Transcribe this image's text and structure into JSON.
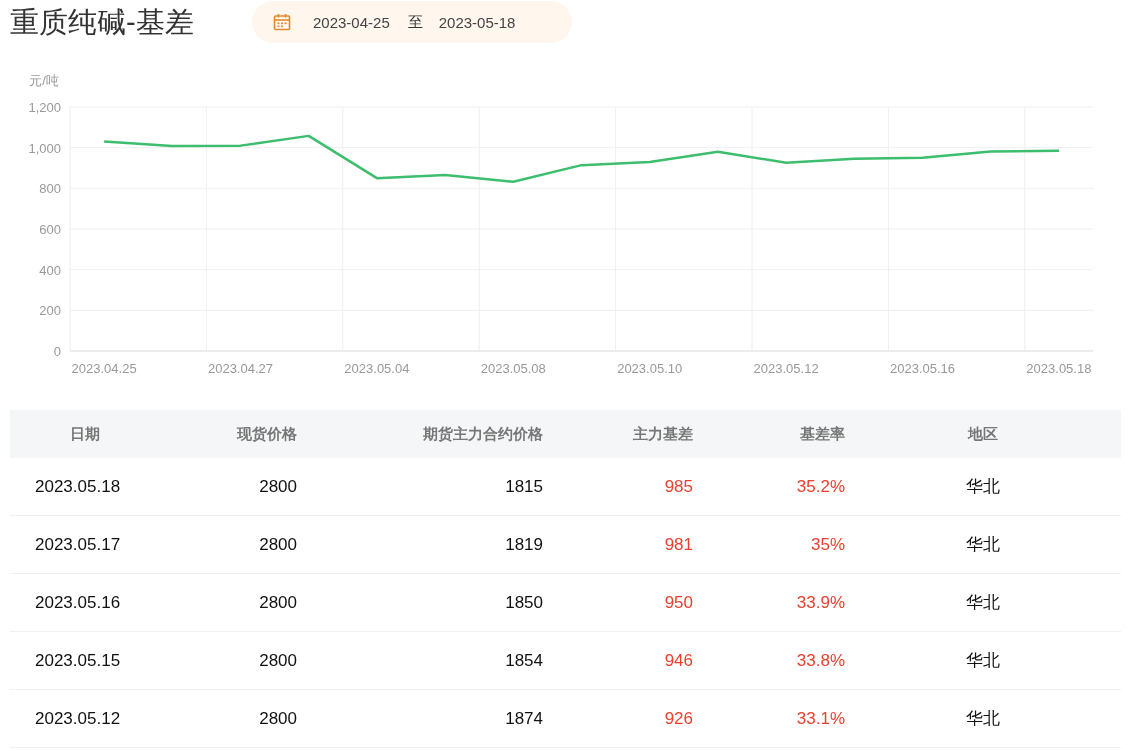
{
  "title": "重质纯碱-基差",
  "date_range": {
    "start": "2023-04-25",
    "separator": "至",
    "end": "2023-05-18"
  },
  "chart": {
    "chart_data": {
      "type": "line",
      "ylabel": "元/吨",
      "categories": [
        "2023.04.25",
        null,
        "2023.04.27",
        null,
        "2023.05.04",
        null,
        "2023.05.08",
        null,
        "2023.05.10",
        null,
        "2023.05.12",
        null,
        "2023.05.16",
        null,
        "2023.05.18"
      ],
      "series": [
        {
          "color": "#3dbd6e",
          "values": [
            1030,
            1008,
            1010,
            1058,
            850,
            866,
            832,
            914,
            930,
            980,
            926,
            946,
            950,
            981,
            985
          ]
        }
      ],
      "ylim": [
        0,
        1200
      ],
      "grid": true,
      "yticks": [
        {
          "value": 0,
          "label": "0"
        },
        {
          "value": 200,
          "label": "200"
        },
        {
          "value": 400,
          "label": "400"
        },
        {
          "value": 600,
          "label": "600"
        },
        {
          "value": 800,
          "label": "800"
        },
        {
          "value": 1000,
          "label": "1,000"
        },
        {
          "value": 1200,
          "label": "1,200"
        }
      ]
    }
  },
  "table": {
    "columns": [
      "日期",
      "现货价格",
      "期货主力合约价格",
      "主力基差",
      "基差率",
      "地区"
    ],
    "rows": [
      [
        "2023.05.18",
        "2800",
        "1815",
        "985",
        "35.2%",
        "华北"
      ],
      [
        "2023.05.17",
        "2800",
        "1819",
        "981",
        "35%",
        "华北"
      ],
      [
        "2023.05.16",
        "2800",
        "1850",
        "950",
        "33.9%",
        "华北"
      ],
      [
        "2023.05.15",
        "2800",
        "1854",
        "946",
        "33.8%",
        "华北"
      ],
      [
        "2023.05.12",
        "2800",
        "1874",
        "926",
        "33.1%",
        "华北"
      ]
    ]
  }
}
